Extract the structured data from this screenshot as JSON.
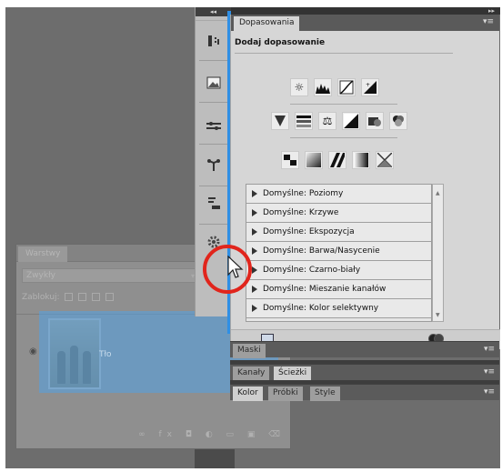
{
  "layers_panel": {
    "tab": "Warstwy",
    "blend_mode": "Zwykły",
    "lock_row": "Zablokuj:",
    "layer_label": "Tło",
    "bottom_icons": "∞ fx ◘ ◐ ▭ ▣ ⌫"
  },
  "dock": {
    "header": "◂◂",
    "icons": [
      "adjustments-icon",
      "masks-icon",
      "channels-icon",
      "paths-icon",
      "styles-icon",
      "settings-icon"
    ]
  },
  "adjustments_panel": {
    "dock_header": "▸▸",
    "tab": "Dopasowania",
    "menu": "▾≡",
    "title": "Dodaj dopasowanie",
    "presets": [
      "Domyślne: Poziomy",
      "Domyślne: Krzywe",
      "Domyślne: Ekspozycja",
      "Domyślne: Barwa/Nasycenie",
      "Domyślne: Czarno-biały",
      "Domyślne: Mieszanie kanałów",
      "Domyślne: Kolor selektywny"
    ]
  },
  "masks_panel": {
    "tab": "Maski",
    "menu": "▾≡"
  },
  "channels_panel": {
    "tabs": [
      "Kanały",
      "Ścieżki"
    ],
    "menu": "▾≡"
  },
  "color_panel": {
    "tabs": [
      "Kolor",
      "Próbki",
      "Style"
    ],
    "menu": "▾≡"
  },
  "colors": {
    "drag_highlight": "#56a0de",
    "insert_line": "#2f8fe5",
    "ring": "#e1251c"
  }
}
